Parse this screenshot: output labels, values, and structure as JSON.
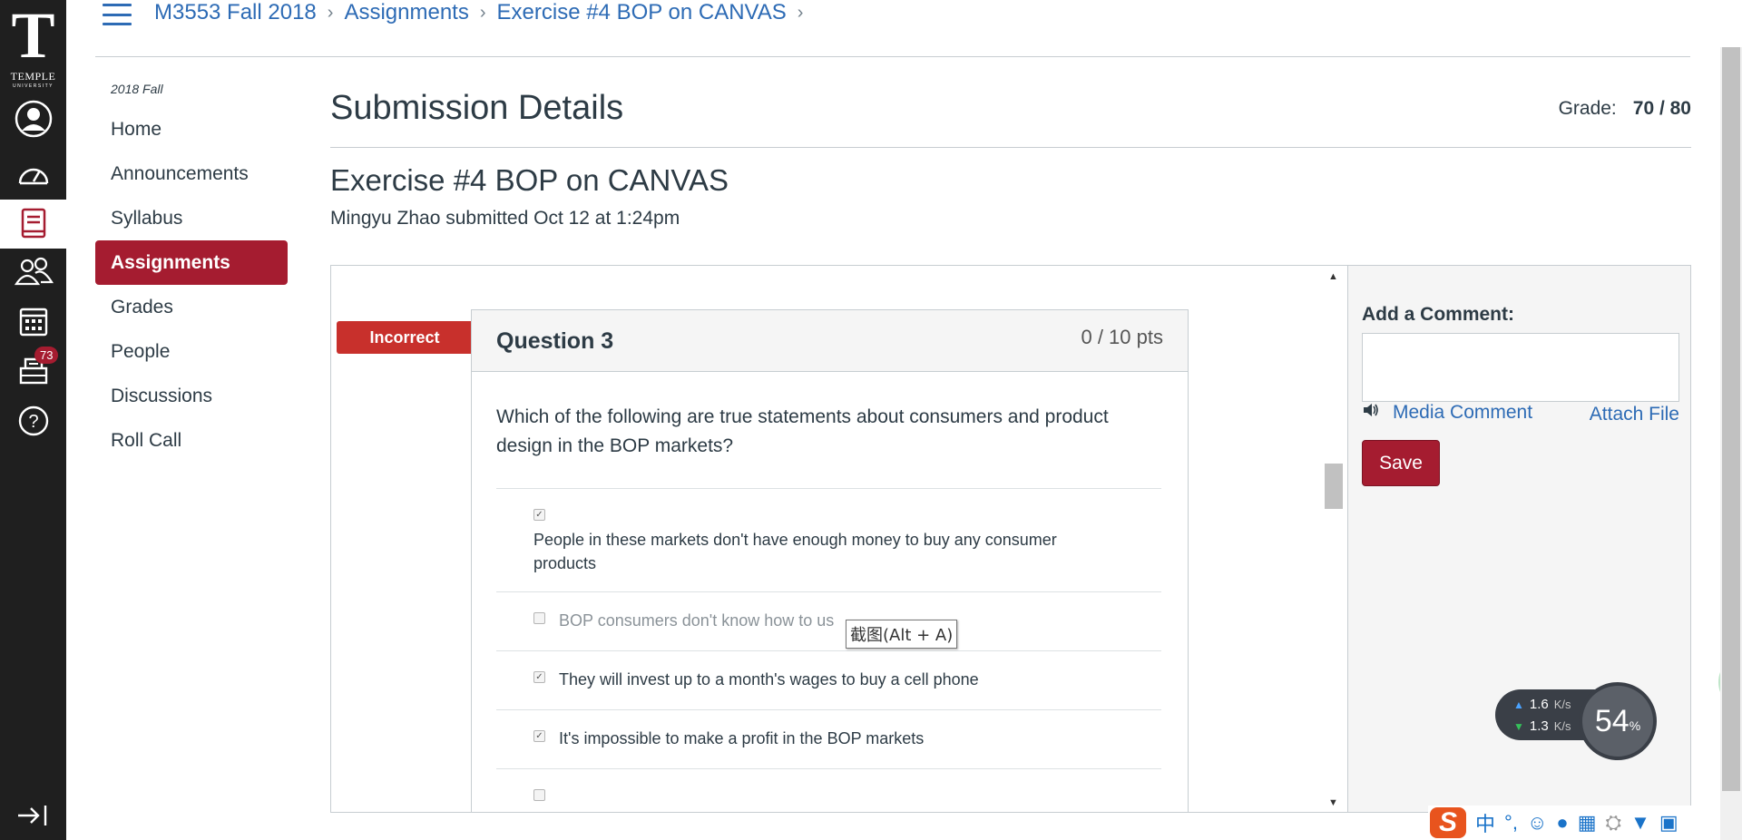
{
  "global_nav": {
    "logo_letter": "T",
    "logo_text": "TEMPLE",
    "logo_subtext": "UNIVERSITY",
    "inbox_badge": "73",
    "icons": [
      "account-icon",
      "dashboard-icon",
      "courses-icon",
      "groups-icon",
      "calendar-icon",
      "inbox-icon",
      "help-icon"
    ]
  },
  "breadcrumb": [
    "M3553 Fall 2018",
    "Assignments",
    "Exercise #4 BOP on CANVAS"
  ],
  "course_nav": {
    "term": "2018 Fall",
    "items": [
      "Home",
      "Announcements",
      "Syllabus",
      "Assignments",
      "Grades",
      "People",
      "Discussions",
      "Roll Call"
    ],
    "active": "Assignments"
  },
  "page": {
    "title": "Submission Details",
    "grade_label": "Grade:",
    "grade_value": "70 / 80",
    "assignment_title": "Exercise #4 BOP on CANVAS",
    "submitted_by": "Mingyu Zhao submitted Oct 12 at 1:24pm"
  },
  "question": {
    "status": "Incorrect",
    "title": "Question 3",
    "points": "0 / 10 pts",
    "text": "Which of the following are true statements about consumers and product design in the BOP markets?",
    "answers": [
      {
        "label": "People in these markets don't have enough money to buy any consumer products",
        "checked": true
      },
      {
        "label": "BOP consumers don't know how to us",
        "checked": false
      },
      {
        "label": "They will invest up to a month's wages to buy a cell phone",
        "checked": true
      },
      {
        "label": "It's impossible to make a profit in the BOP markets",
        "checked": true
      },
      {
        "label": "",
        "checked": false
      }
    ]
  },
  "tooltip": "截图(Alt + A)",
  "comment_panel": {
    "title": "Add a Comment:",
    "media_comment": "Media Comment",
    "attach_file": "Attach File",
    "save": "Save"
  },
  "speed_widget": {
    "upload": "1.6",
    "download": "1.3",
    "unit": "K/s",
    "percent": "54",
    "percent_sign": "%",
    "side_ball": "54"
  },
  "ime_tray": {
    "logo": "S",
    "chars": [
      "中",
      "°,"
    ]
  },
  "colors": {
    "brand": "#a51c30",
    "link": "#2d6bb5",
    "incorrect": "#c8302c",
    "nav_bg": "#1f1f1f"
  }
}
